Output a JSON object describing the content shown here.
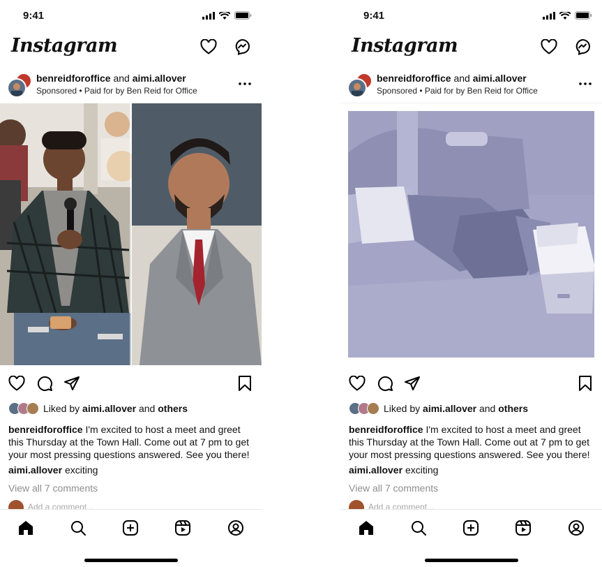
{
  "screens": [
    {
      "status_time": "9:41",
      "logo": "Instagram",
      "post": {
        "user1": "benreidforoffice",
        "connector": "and",
        "user2": "aimi.allover",
        "sponsored": "Sponsored • Paid for by Ben Reid for Office",
        "liked_prefix": "Liked by",
        "liked_user": "aimi.allover",
        "liked_and": "and",
        "liked_others": "others",
        "caption_user": "benreidforoffice",
        "caption_text": "I'm excited to host a meet and greet this Thursday at the Town Hall. Come out at 7 pm to get your most pressing questions answered. See you there!",
        "comment_user": "aimi.allover",
        "comment_text": "exciting",
        "view_all": "View all 7 comments",
        "add_comment": "Add a comment..."
      }
    },
    {
      "status_time": "9:41",
      "logo": "Instagram",
      "post": {
        "user1": "benreidforoffice",
        "connector": "and",
        "user2": "aimi.allover",
        "sponsored": "Sponsored • Paid for by Ben Reid for Office",
        "liked_prefix": "Liked by",
        "liked_user": "aimi.allover",
        "liked_and": "and",
        "liked_others": "others",
        "caption_user": "benreidforoffice",
        "caption_text": "I'm excited to host a meet and greet this Thursday at the Town Hall. Come out at 7 pm to get your most pressing questions answered. See you there!",
        "comment_user": "aimi.allover",
        "comment_text": "exciting",
        "view_all": "View all 7 comments",
        "add_comment": "Add a comment..."
      }
    }
  ],
  "icons": {
    "header": [
      "heart-icon",
      "messenger-icon"
    ],
    "actions": [
      "heart-icon",
      "comment-icon",
      "share-icon",
      "bookmark-icon"
    ],
    "tabs": [
      "home-icon",
      "search-icon",
      "create-icon",
      "reels-icon",
      "profile-icon"
    ]
  },
  "colors": {
    "text": "#111111",
    "muted": "#8e8e8e",
    "handshake_tint": "#a3a4c6"
  }
}
